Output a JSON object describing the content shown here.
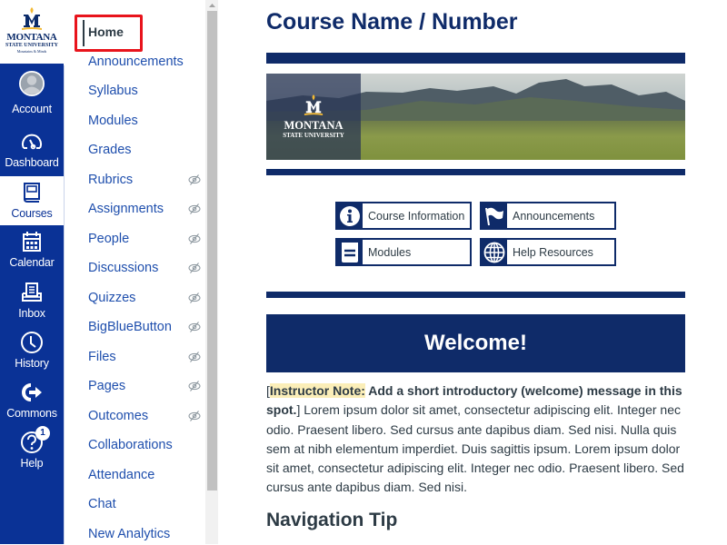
{
  "global_nav": {
    "logo": {
      "title": "MONTANA",
      "subtitle": "STATE UNIVERSITY",
      "tagline": "Mountains & Minds"
    },
    "items": [
      {
        "label": "Account",
        "icon": "avatar-icon",
        "active": false
      },
      {
        "label": "Dashboard",
        "icon": "dashboard-gauge-icon",
        "active": false
      },
      {
        "label": "Courses",
        "icon": "book-icon",
        "active": true
      },
      {
        "label": "Calendar",
        "icon": "calendar-icon",
        "active": false
      },
      {
        "label": "Inbox",
        "icon": "inbox-icon",
        "active": false
      },
      {
        "label": "History",
        "icon": "clock-icon",
        "active": false
      },
      {
        "label": "Commons",
        "icon": "commons-arrow-icon",
        "active": false
      },
      {
        "label": "Help",
        "icon": "help-question-icon",
        "active": false,
        "badge": "1"
      }
    ]
  },
  "course_nav": {
    "items": [
      {
        "label": "Home",
        "active": true,
        "hidden_from_students": false
      },
      {
        "label": "Announcements",
        "hidden_from_students": false
      },
      {
        "label": "Syllabus",
        "hidden_from_students": false
      },
      {
        "label": "Modules",
        "hidden_from_students": false
      },
      {
        "label": "Grades",
        "hidden_from_students": false
      },
      {
        "label": "Rubrics",
        "hidden_from_students": true
      },
      {
        "label": "Assignments",
        "hidden_from_students": true
      },
      {
        "label": "People",
        "hidden_from_students": true
      },
      {
        "label": "Discussions",
        "hidden_from_students": true
      },
      {
        "label": "Quizzes",
        "hidden_from_students": true
      },
      {
        "label": "BigBlueButton",
        "hidden_from_students": true
      },
      {
        "label": "Files",
        "hidden_from_students": true
      },
      {
        "label": "Pages",
        "hidden_from_students": true
      },
      {
        "label": "Outcomes",
        "hidden_from_students": true
      },
      {
        "label": "Collaborations",
        "hidden_from_students": false
      },
      {
        "label": "Attendance",
        "hidden_from_students": false
      },
      {
        "label": "Chat",
        "hidden_from_students": false
      },
      {
        "label": "New Analytics",
        "hidden_from_students": false
      }
    ]
  },
  "main": {
    "title": "Course Name / Number",
    "banner": {
      "logo_title": "MONTANA",
      "logo_subtitle": "STATE UNIVERSITY"
    },
    "quick_links": [
      {
        "label": "Course Information",
        "icon": "info-icon"
      },
      {
        "label": "Announcements",
        "icon": "flag-icon"
      },
      {
        "label": "Modules",
        "icon": "modules-list-icon"
      },
      {
        "label": "Help Resources",
        "icon": "globe-icon"
      }
    ],
    "welcome_heading": "Welcome!",
    "intro": {
      "open_bracket": "[",
      "note_label": "Instructor Note:",
      "note_text": " Add a short introductory (welcome) message in this spot.",
      "close_bracket": "]",
      "body": " Lorem ipsum dolor sit amet, consectetur adipiscing elit. Integer nec odio. Praesent libero. Sed cursus ante dapibus diam. Sed nisi. Nulla quis sem at nibh elementum imperdiet. Duis sagittis ipsum. Lorem ipsum dolor sit amet, consectetur adipiscing elit. Integer nec odio. Praesent libero. Sed cursus ante dapibus diam. Sed nisi."
    },
    "subheading": "Navigation Tip"
  },
  "colors": {
    "global_nav_bg": "#0a3296",
    "brand_navy": "#0f2b69",
    "link_blue": "#1f4fad",
    "highlight_red": "#e8141c",
    "note_highlight": "#fbeeb8",
    "text": "#2d3b45"
  }
}
